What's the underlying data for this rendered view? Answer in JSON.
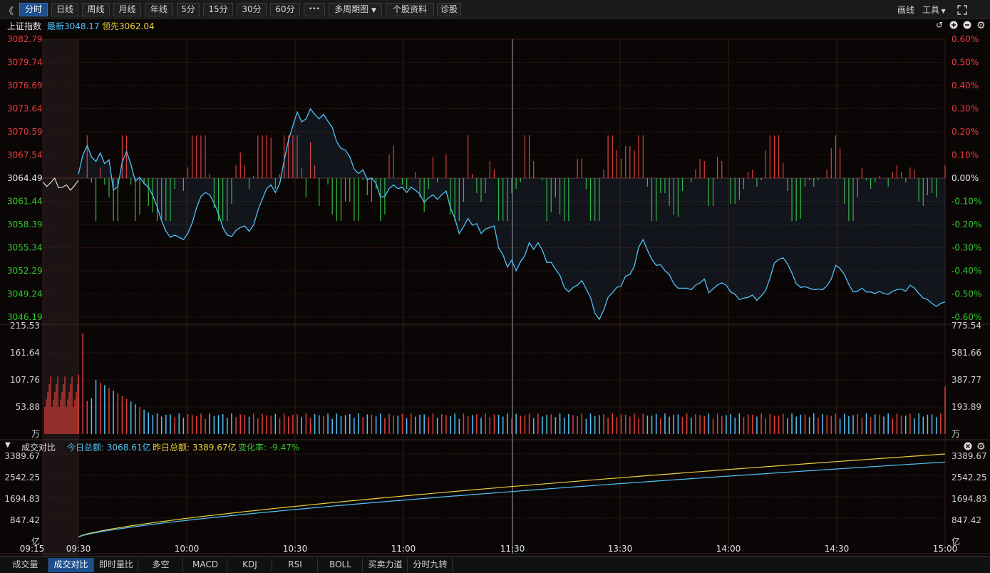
{
  "toolbar": {
    "collapse_glyph": "《",
    "periods": [
      "分时",
      "日线",
      "周线",
      "月线",
      "年线",
      "5分",
      "15分",
      "30分",
      "60分"
    ],
    "active_period": "分时",
    "more_glyph": "•••",
    "multi_period": "多周期图",
    "stock_info": "个股资料",
    "diagnose": "诊股",
    "draw": "画线",
    "tools": "工具"
  },
  "header": {
    "name": "上证指数",
    "latest": "最新3048.17",
    "leading": "领先3062.04"
  },
  "colors": {
    "price_line": "#4fc3f7",
    "lead_line": "#ffffff",
    "up": "#e0403a",
    "down": "#2fbf3a",
    "yellow": "#e8d23a",
    "blue": "#4fc3f7",
    "grid": "#3a1818",
    "axis_red": "#e83c3c",
    "axis_green": "#32c832"
  },
  "price_axis": {
    "left": [
      "3082.79",
      "3079.74",
      "3076.69",
      "3073.64",
      "3070.59",
      "3067.54",
      "3064.49",
      "3061.44",
      "3058.39",
      "3055.34",
      "3052.29",
      "3049.24",
      "3046.19"
    ],
    "right": [
      "0.60%",
      "0.50%",
      "0.40%",
      "0.30%",
      "0.20%",
      "0.10%",
      "0.00%",
      "-0.10%",
      "-0.20%",
      "-0.30%",
      "-0.40%",
      "-0.50%",
      "-0.60%"
    ]
  },
  "volume_axis": {
    "left": [
      "215.53",
      "161.64",
      "107.76",
      "53.88",
      "万"
    ],
    "right": [
      "775.54",
      "581.66",
      "387.77",
      "193.89",
      "万"
    ]
  },
  "turnover_panel": {
    "collapse_glyph": "▼",
    "title": "成交对比",
    "today_label": "今日总额:",
    "today_value": "3068.61亿",
    "yesterday_label": "昨日总额:",
    "yesterday_value": "3389.67亿",
    "change_label": "变化率:",
    "change_value": "-9.47%",
    "axis_left": [
      "3389.67",
      "2542.25",
      "1694.83",
      "847.42",
      "亿"
    ],
    "axis_right": [
      "3389.67",
      "2542.25",
      "1694.83",
      "847.42",
      "亿"
    ]
  },
  "time_axis": [
    "09:15",
    "09:30",
    "10:00",
    "10:30",
    "11:00",
    "11:30",
    "13:30",
    "14:00",
    "14:30",
    "15:00"
  ],
  "bottom_tabs": [
    "成交量",
    "成交对比",
    "即时量比",
    "多空",
    "MACD",
    "KDJ",
    "RSI",
    "BOLL",
    "买卖力道",
    "分时九转"
  ],
  "active_bottom_tab": "成交对比",
  "chart_data": {
    "type": "line",
    "title": "上证指数",
    "prev_close": 3064.49,
    "ylim": [
      3046.19,
      3082.79
    ],
    "x_ticks": [
      "09:15",
      "09:30",
      "10:00",
      "10:30",
      "11:00",
      "11:30",
      "13:30",
      "14:00",
      "14:30",
      "15:00"
    ],
    "series": [
      {
        "name": "最新",
        "values": [
          3065.0,
          3067.5,
          3068.8,
          3067.3,
          3066.7,
          3067.8,
          3066.4,
          3066.9,
          3062.9,
          3063.4,
          3066.6,
          3068.0,
          3066.3,
          3064.1,
          3064.6,
          3063.8,
          3063.3,
          3062.2,
          3060.7,
          3058.9,
          3057.5,
          3056.7,
          3057.0,
          3056.7,
          3056.4,
          3057.2,
          3058.6,
          3060.6,
          3062.1,
          3062.6,
          3062.3,
          3061.2,
          3059.8,
          3058.0,
          3057.0,
          3056.8,
          3057.6,
          3058.0,
          3058.2,
          3057.5,
          3058.3,
          3060.2,
          3061.7,
          3063.1,
          3063.6,
          3062.6,
          3063.8,
          3066.8,
          3069.5,
          3071.4,
          3073.2,
          3071.9,
          3072.3,
          3073.6,
          3072.9,
          3072.3,
          3072.9,
          3072.0,
          3071.2,
          3069.3,
          3068.4,
          3068.2,
          3067.3,
          3065.7,
          3065.1,
          3065.6,
          3064.3,
          3064.5,
          3063.8,
          3062.0,
          3062.1,
          3063.1,
          3063.6,
          3063.1,
          3063.3,
          3062.6,
          3063.3,
          3062.9,
          3062.4,
          3061.3,
          3061.9,
          3062.3,
          3061.7,
          3062.3,
          3062.8,
          3060.6,
          3059.2,
          3057.2,
          3058.1,
          3059.2,
          3058.3,
          3058.5,
          3057.2,
          3057.8,
          3058.0,
          3058.2,
          3055.3,
          3054.4,
          3052.8,
          3053.7,
          3052.3,
          3053.5,
          3054.3,
          3056.0,
          3055.1,
          3056.0,
          3055.0,
          3053.4,
          3053.4,
          3052.5,
          3051.7,
          3050.1,
          3049.5,
          3050.1,
          3050.4,
          3051.0,
          3049.9,
          3048.8,
          3046.7,
          3045.9,
          3047.1,
          3048.8,
          3049.4,
          3050.1,
          3050.3,
          3051.6,
          3051.8,
          3052.9,
          3055.4,
          3056.4,
          3055.0,
          3053.8,
          3053.0,
          3053.1,
          3052.3,
          3051.8,
          3050.6,
          3050.0,
          3050.0,
          3050.0,
          3049.8,
          3050.4,
          3050.7,
          3051.2,
          3049.4,
          3049.9,
          3050.4,
          3050.7,
          3050.4,
          3049.5,
          3049.2,
          3048.5,
          3048.7,
          3048.8,
          3049.1,
          3048.4,
          3049.0,
          3049.7,
          3051.3,
          3053.3,
          3053.8,
          3054.0,
          3053.2,
          3052.0,
          3050.6,
          3050.1,
          3050.2,
          3050.0,
          3049.8,
          3049.9,
          3049.8,
          3050.3,
          3051.2,
          3053.0,
          3052.6,
          3051.8,
          3050.5,
          3049.5,
          3049.6,
          3050.0,
          3049.5,
          3049.5,
          3049.3,
          3049.6,
          3049.3,
          3049.2,
          3049.6,
          3049.8,
          3049.9,
          3049.6,
          3050.4,
          3050.0,
          3049.3,
          3048.7,
          3048.5,
          3048.0,
          3047.6,
          3048.0,
          3048.2
        ]
      },
      {
        "name": "领先",
        "values": [
          3064.0,
          3063.4,
          3063.9,
          3064.5,
          3063.2,
          3063.3,
          3063.6,
          3062.9,
          3063.5,
          3064.2
        ]
      }
    ],
    "volume_left_max": 215.53,
    "volume_right_max": 775.54,
    "turnover": {
      "ylim": [
        0,
        3389.67
      ],
      "today_total": 3068.61,
      "yesterday_total": 3389.67
    }
  }
}
